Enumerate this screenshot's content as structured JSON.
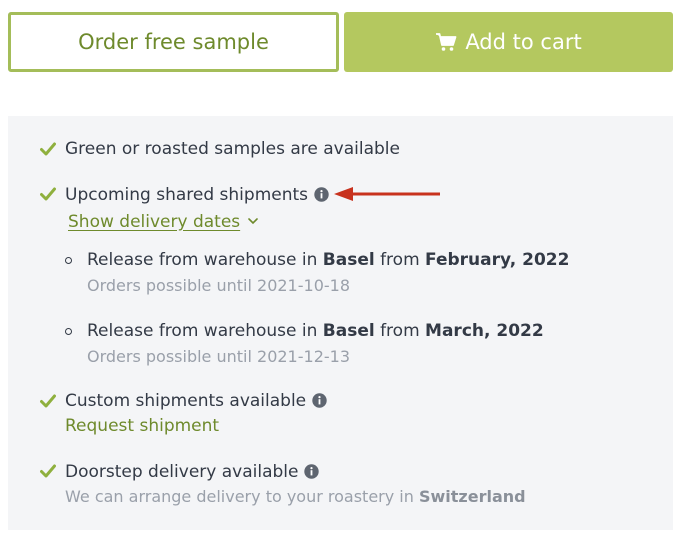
{
  "buttons": {
    "sample_label": "Order free sample",
    "cart_label": "Add to cart",
    "cart_icon": "shopping-cart-icon"
  },
  "features": [
    {
      "text": "Green or roasted samples are available"
    },
    {
      "text": "Upcoming shared shipments",
      "info": true
    },
    {
      "text": "Custom shipments available",
      "info": true,
      "link": "Request shipment"
    },
    {
      "text": "Doorstep delivery available",
      "info": true,
      "note_prefix": "We can arrange delivery to your roastery in ",
      "note_bold": "Switzerland"
    }
  ],
  "delivery_toggle": "Show delivery dates",
  "shipments": [
    {
      "prefix": "Release from warehouse in ",
      "warehouse": "Basel",
      "mid": " from ",
      "date": "February, 2022",
      "orders": "Orders possible until 2021-10-18"
    },
    {
      "prefix": "Release from warehouse in ",
      "warehouse": "Basel",
      "mid": " from ",
      "date": "March, 2022",
      "orders": "Orders possible until 2021-12-13"
    }
  ],
  "colors": {
    "accent": "#b4c85f",
    "accent_dark": "#6e8a2c",
    "check": "#8fb03e",
    "panel_bg": "#f4f5f7",
    "arrow": "#c8321e"
  }
}
